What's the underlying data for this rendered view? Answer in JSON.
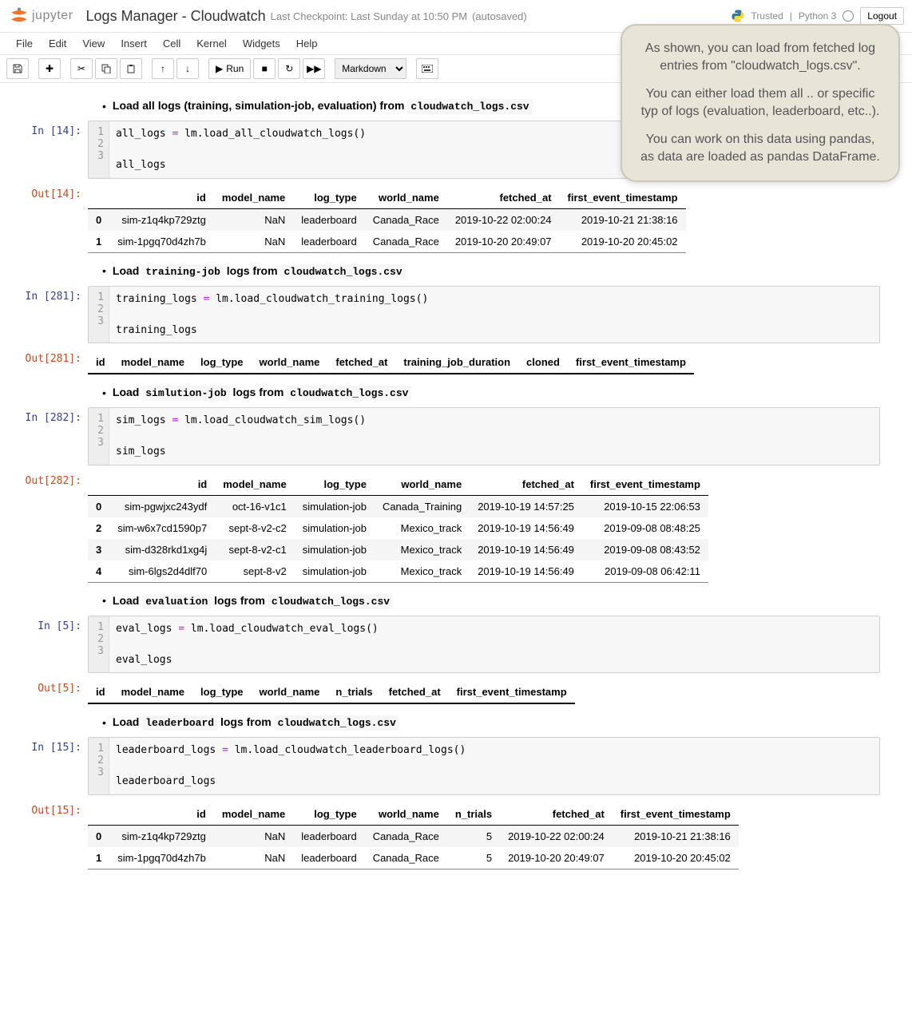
{
  "header": {
    "logo_text": "jupyter",
    "title": "Logs Manager - Cloudwatch",
    "checkpoint": "Last Checkpoint: Last Sunday at 10:50 PM",
    "autosaved": "(autosaved)",
    "trusted": "Trusted",
    "kernel": "Python 3",
    "logout": "Logout"
  },
  "menu": [
    "File",
    "Edit",
    "View",
    "Insert",
    "Cell",
    "Kernel",
    "Widgets",
    "Help"
  ],
  "toolbar": {
    "run_label": "Run",
    "cell_type": "Markdown"
  },
  "tooltip": {
    "p1": "As shown, you can load from fetched log entries from \"cloudwatch_logs.csv\".",
    "p2": "You can either load them all .. or specific typ of logs (evaluation, leaderboard, etc..).",
    "p3": "You can work on this data using pandas, as data are loaded as pandas DataFrame."
  },
  "cells": {
    "md1_prefix": "Load all logs (training, simulation-job, evaluation) from ",
    "file_csv": "cloudwatch_logs.csv",
    "md2_prefix": "Load ",
    "md2_code": "training-job",
    "md2_suffix": " logs from ",
    "md3_code": "simlution-job",
    "md4_code": "evaluation",
    "md5_code": "leaderboard",
    "in14": "In [14]:",
    "out14": "Out[14]:",
    "in281": "In [281]:",
    "out281": "Out[281]:",
    "in282": "In [282]:",
    "out282": "Out[282]:",
    "in5": "In [5]:",
    "out5": "Out[5]:",
    "in15": "In [15]:",
    "out15": "Out[15]:",
    "code14_l1": "all_logs = lm.load_all_cloudwatch_logs()",
    "code14_l3": "all_logs",
    "code281_l1": "training_logs = lm.load_cloudwatch_training_logs()",
    "code281_l3": "training_logs",
    "code282_l1": "sim_logs = lm.load_cloudwatch_sim_logs()",
    "code282_l3": "sim_logs",
    "code5_l1": "eval_logs = lm.load_cloudwatch_eval_logs()",
    "code5_l3": "eval_logs",
    "code15_l1": "leaderboard_logs = lm.load_cloudwatch_leaderboard_logs()",
    "code15_l3": "leaderboard_logs"
  },
  "tables": {
    "t14": {
      "cols": [
        "",
        "id",
        "model_name",
        "log_type",
        "world_name",
        "fetched_at",
        "first_event_timestamp"
      ],
      "rows": [
        [
          "0",
          "sim-z1q4kp729ztg",
          "NaN",
          "leaderboard",
          "Canada_Race",
          "2019-10-22 02:00:24",
          "2019-10-21 21:38:16"
        ],
        [
          "1",
          "sim-1pgq70d4zh7b",
          "NaN",
          "leaderboard",
          "Canada_Race",
          "2019-10-20 20:49:07",
          "2019-10-20 20:45:02"
        ]
      ]
    },
    "t281": {
      "cols": [
        "id",
        "model_name",
        "log_type",
        "world_name",
        "fetched_at",
        "training_job_duration",
        "cloned",
        "first_event_timestamp"
      ]
    },
    "t282": {
      "cols": [
        "",
        "id",
        "model_name",
        "log_type",
        "world_name",
        "fetched_at",
        "first_event_timestamp"
      ],
      "rows": [
        [
          "0",
          "sim-pgwjxc243ydf",
          "oct-16-v1c1",
          "simulation-job",
          "Canada_Training",
          "2019-10-19 14:57:25",
          "2019-10-15 22:06:53"
        ],
        [
          "2",
          "sim-w6x7cd1590p7",
          "sept-8-v2-c2",
          "simulation-job",
          "Mexico_track",
          "2019-10-19 14:56:49",
          "2019-09-08 08:48:25"
        ],
        [
          "3",
          "sim-d328rkd1xg4j",
          "sept-8-v2-c1",
          "simulation-job",
          "Mexico_track",
          "2019-10-19 14:56:49",
          "2019-09-08 08:43:52"
        ],
        [
          "4",
          "sim-6lgs2d4dlf70",
          "sept-8-v2",
          "simulation-job",
          "Mexico_track",
          "2019-10-19 14:56:49",
          "2019-09-08 06:42:11"
        ]
      ]
    },
    "t5": {
      "cols": [
        "id",
        "model_name",
        "log_type",
        "world_name",
        "n_trials",
        "fetched_at",
        "first_event_timestamp"
      ]
    },
    "t15": {
      "cols": [
        "",
        "id",
        "model_name",
        "log_type",
        "world_name",
        "n_trials",
        "fetched_at",
        "first_event_timestamp"
      ],
      "rows": [
        [
          "0",
          "sim-z1q4kp729ztg",
          "NaN",
          "leaderboard",
          "Canada_Race",
          "5",
          "2019-10-22 02:00:24",
          "2019-10-21 21:38:16"
        ],
        [
          "1",
          "sim-1pgq70d4zh7b",
          "NaN",
          "leaderboard",
          "Canada_Race",
          "5",
          "2019-10-20 20:49:07",
          "2019-10-20 20:45:02"
        ]
      ]
    }
  }
}
